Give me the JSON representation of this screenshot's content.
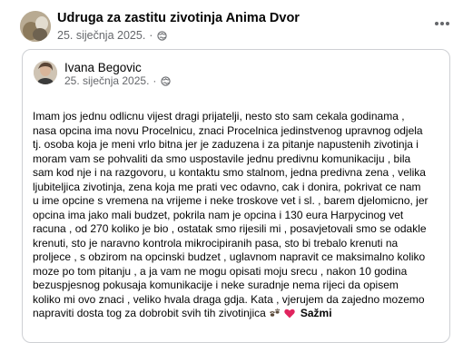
{
  "page": {
    "name": "Udruga za zastitu zivotinja Anima Dvor",
    "date": "25. siječnja 2025.",
    "separator": "·"
  },
  "shared_post": {
    "author": "Ivana Begovic",
    "date": "25. siječnja 2025.",
    "separator": "·",
    "text_lines": [
      "Imam jos jednu odlicnu vijest dragi prijatelji, nesto sto sam cekala godinama ,",
      "nasa opcina ima novu Procelnicu, znaci Procelnica jedinstvenog upravnog odjela",
      "tj. osoba koja je meni vrlo bitna jer je zaduzena i za pitanje napustenih zivotinja i",
      "moram vam se pohvaliti da smo uspostavile jednu predivnu komunikaciju , bila",
      "sam kod nje i na razgovoru, u kontaktu smo stalnom, jedna predivna zena , velika",
      "ljubiteljica zivotinja, zena koja me prati vec odavno, cak i donira, pokrivat ce nam",
      "u ime opcine s vremena na vrijeme i neke troskove vet i sl. , barem djelomicno, jer",
      "opcina ima jako mali budzet, pokrila nam je opcina i 130 eura  Harpycinog vet",
      "racuna , od 270 koliko je bio , ostatak smo rijesili mi , posavjetovali smo se odakle",
      "krenuti, sto je naravno kontrola mikrocipiranih pasa, sto bi trebalo krenuti na",
      "proljece , s obzirom na opcinski budzet , uglavnom napravit ce maksimalno koliko",
      "moze po tom pitanju , a ja vam ne mogu opisati moju srecu , nakon 10 godina",
      "bezuspjesnog pokusaja komunikacije i neke suradnje nema rijeci da opisem",
      "koliko mi ovo znaci , veliko hvala draga gdja. Kata , vjerujem da zajedno mozemo",
      "napraviti dosta tog za dobrobit svih tih zivotinjica"
    ],
    "see_more_label": "Sažmi"
  },
  "icons": {
    "privacy": "globe-icon",
    "menu": "more-options-icon",
    "paws": "paw-prints-icon",
    "heart": "red-heart-icon"
  },
  "colors": {
    "heart": "#e0245e",
    "meta_text": "#65676b"
  }
}
